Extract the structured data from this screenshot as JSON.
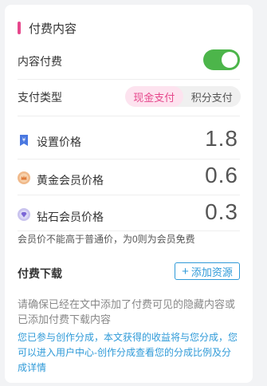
{
  "card": {
    "title": "付费内容"
  },
  "content_pay": {
    "label": "内容付费",
    "enabled": true
  },
  "pay_type": {
    "label": "支付类型",
    "options": [
      "现金支付",
      "积分支付"
    ],
    "selected": "现金支付"
  },
  "prices": [
    {
      "icon": "tag-icon",
      "label": "设置价格",
      "value": "1.8"
    },
    {
      "icon": "gold-member-icon",
      "label": "黄金会员价格",
      "value": "0.6"
    },
    {
      "icon": "diamond-member-icon",
      "label": "钻石会员价格",
      "value": "0.3"
    }
  ],
  "price_note": "会员价不能高于普通价，为0则为会员免费",
  "download": {
    "label": "付费下载",
    "add_button": "添加资源",
    "hint": "请确保已经在文中添加了付费可见的隐藏内容或已添加付费下载内容",
    "info": "您已参与创作分成，本文获得的收益将与您分成，您可以进入用户中心-创作分成查看您的分成比例及分成详情"
  },
  "colors": {
    "accent_pink": "#e6488c",
    "toggle_green": "#4cb54a",
    "link_blue": "#2f9ad8"
  }
}
